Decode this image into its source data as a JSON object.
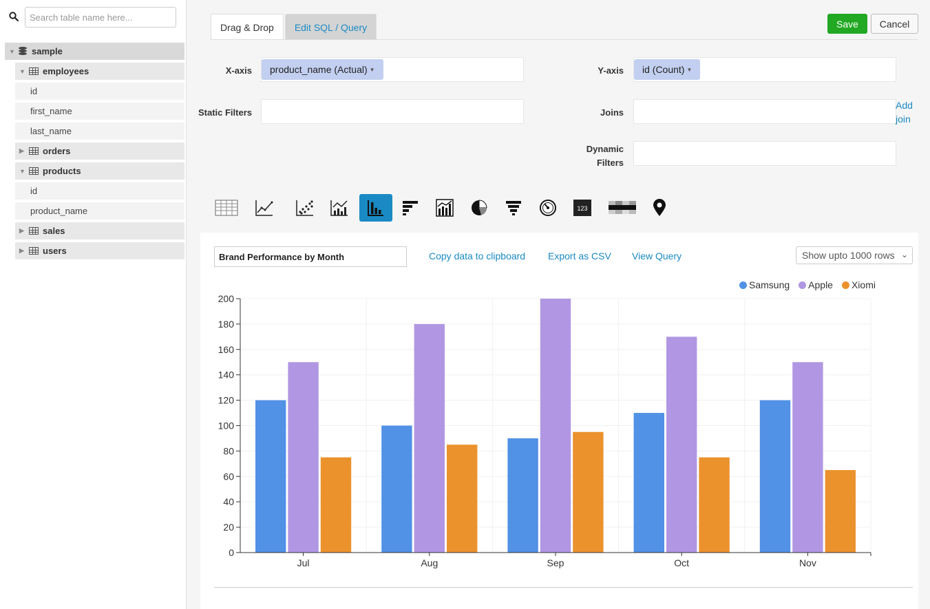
{
  "sidebar": {
    "search": {
      "placeholder": "Search table name here..."
    },
    "tree": [
      {
        "kind": "db",
        "label": "sample",
        "expanded": true
      },
      {
        "kind": "table",
        "label": "employees",
        "expanded": true
      },
      {
        "kind": "col",
        "label": "id"
      },
      {
        "kind": "col",
        "label": "first_name"
      },
      {
        "kind": "col",
        "label": "last_name"
      },
      {
        "kind": "table",
        "label": "orders",
        "expanded": false
      },
      {
        "kind": "table",
        "label": "products",
        "expanded": true
      },
      {
        "kind": "col",
        "label": "id"
      },
      {
        "kind": "col",
        "label": "product_name"
      },
      {
        "kind": "table",
        "label": "sales",
        "expanded": false
      },
      {
        "kind": "table",
        "label": "users",
        "expanded": false
      }
    ]
  },
  "tabs": {
    "drag_drop": "Drag & Drop",
    "edit_sql": "Edit SQL / Query"
  },
  "buttons": {
    "save": "Save",
    "cancel": "Cancel"
  },
  "form": {
    "x_axis_label": "X-axis",
    "x_axis_value": "product_name (Actual)",
    "y_axis_label": "Y-axis",
    "y_axis_value": "id (Count)",
    "static_filters_label": "Static Filters",
    "joins_label": "Joins",
    "add_join": "Add join",
    "dynamic_filters_label": "Dynamic Filters"
  },
  "chart_types": [
    {
      "name": "table-view-icon",
      "active": false
    },
    {
      "name": "line-chart-icon",
      "active": false
    },
    {
      "name": "scatter-chart-icon",
      "active": false
    },
    {
      "name": "line-bar-combo-icon",
      "active": false
    },
    {
      "name": "bar-chart-icon",
      "active": true
    },
    {
      "name": "horizontal-bar-chart-icon",
      "active": false
    },
    {
      "name": "area-bar-chart-icon",
      "active": false
    },
    {
      "name": "pie-chart-icon",
      "active": false
    },
    {
      "name": "funnel-chart-icon",
      "active": false
    },
    {
      "name": "gauge-chart-icon",
      "active": false
    },
    {
      "name": "number-card-icon",
      "active": false,
      "text": "123"
    },
    {
      "name": "heatmap-icon",
      "active": false
    },
    {
      "name": "map-pin-icon",
      "active": false
    }
  ],
  "panel": {
    "title_value": "Brand Performance by Month",
    "copy_data": "Copy data to clipboard",
    "export_csv": "Export as CSV",
    "view_query": "View Query",
    "rows_select": "Show upto 1000 rows"
  },
  "colors": {
    "samsung": "#5191e6",
    "apple": "#b197e3",
    "xiomi": "#eb922d",
    "accent": "#1a8ac4",
    "save": "#22a822"
  },
  "chart_data": {
    "type": "bar",
    "categories": [
      "Jul",
      "Aug",
      "Sep",
      "Oct",
      "Nov"
    ],
    "series": [
      {
        "name": "Samsung",
        "values": [
          120,
          100,
          90,
          110,
          120
        ]
      },
      {
        "name": "Apple",
        "values": [
          150,
          180,
          200,
          170,
          150
        ]
      },
      {
        "name": "Xiomi",
        "values": [
          75,
          85,
          95,
          75,
          65
        ]
      }
    ],
    "yticks": [
      "0",
      "20",
      "40",
      "60",
      "80",
      "100",
      "120",
      "140",
      "160",
      "180",
      "200"
    ],
    "ylim": [
      0,
      200
    ],
    "legend": "top-right",
    "grid": true
  }
}
